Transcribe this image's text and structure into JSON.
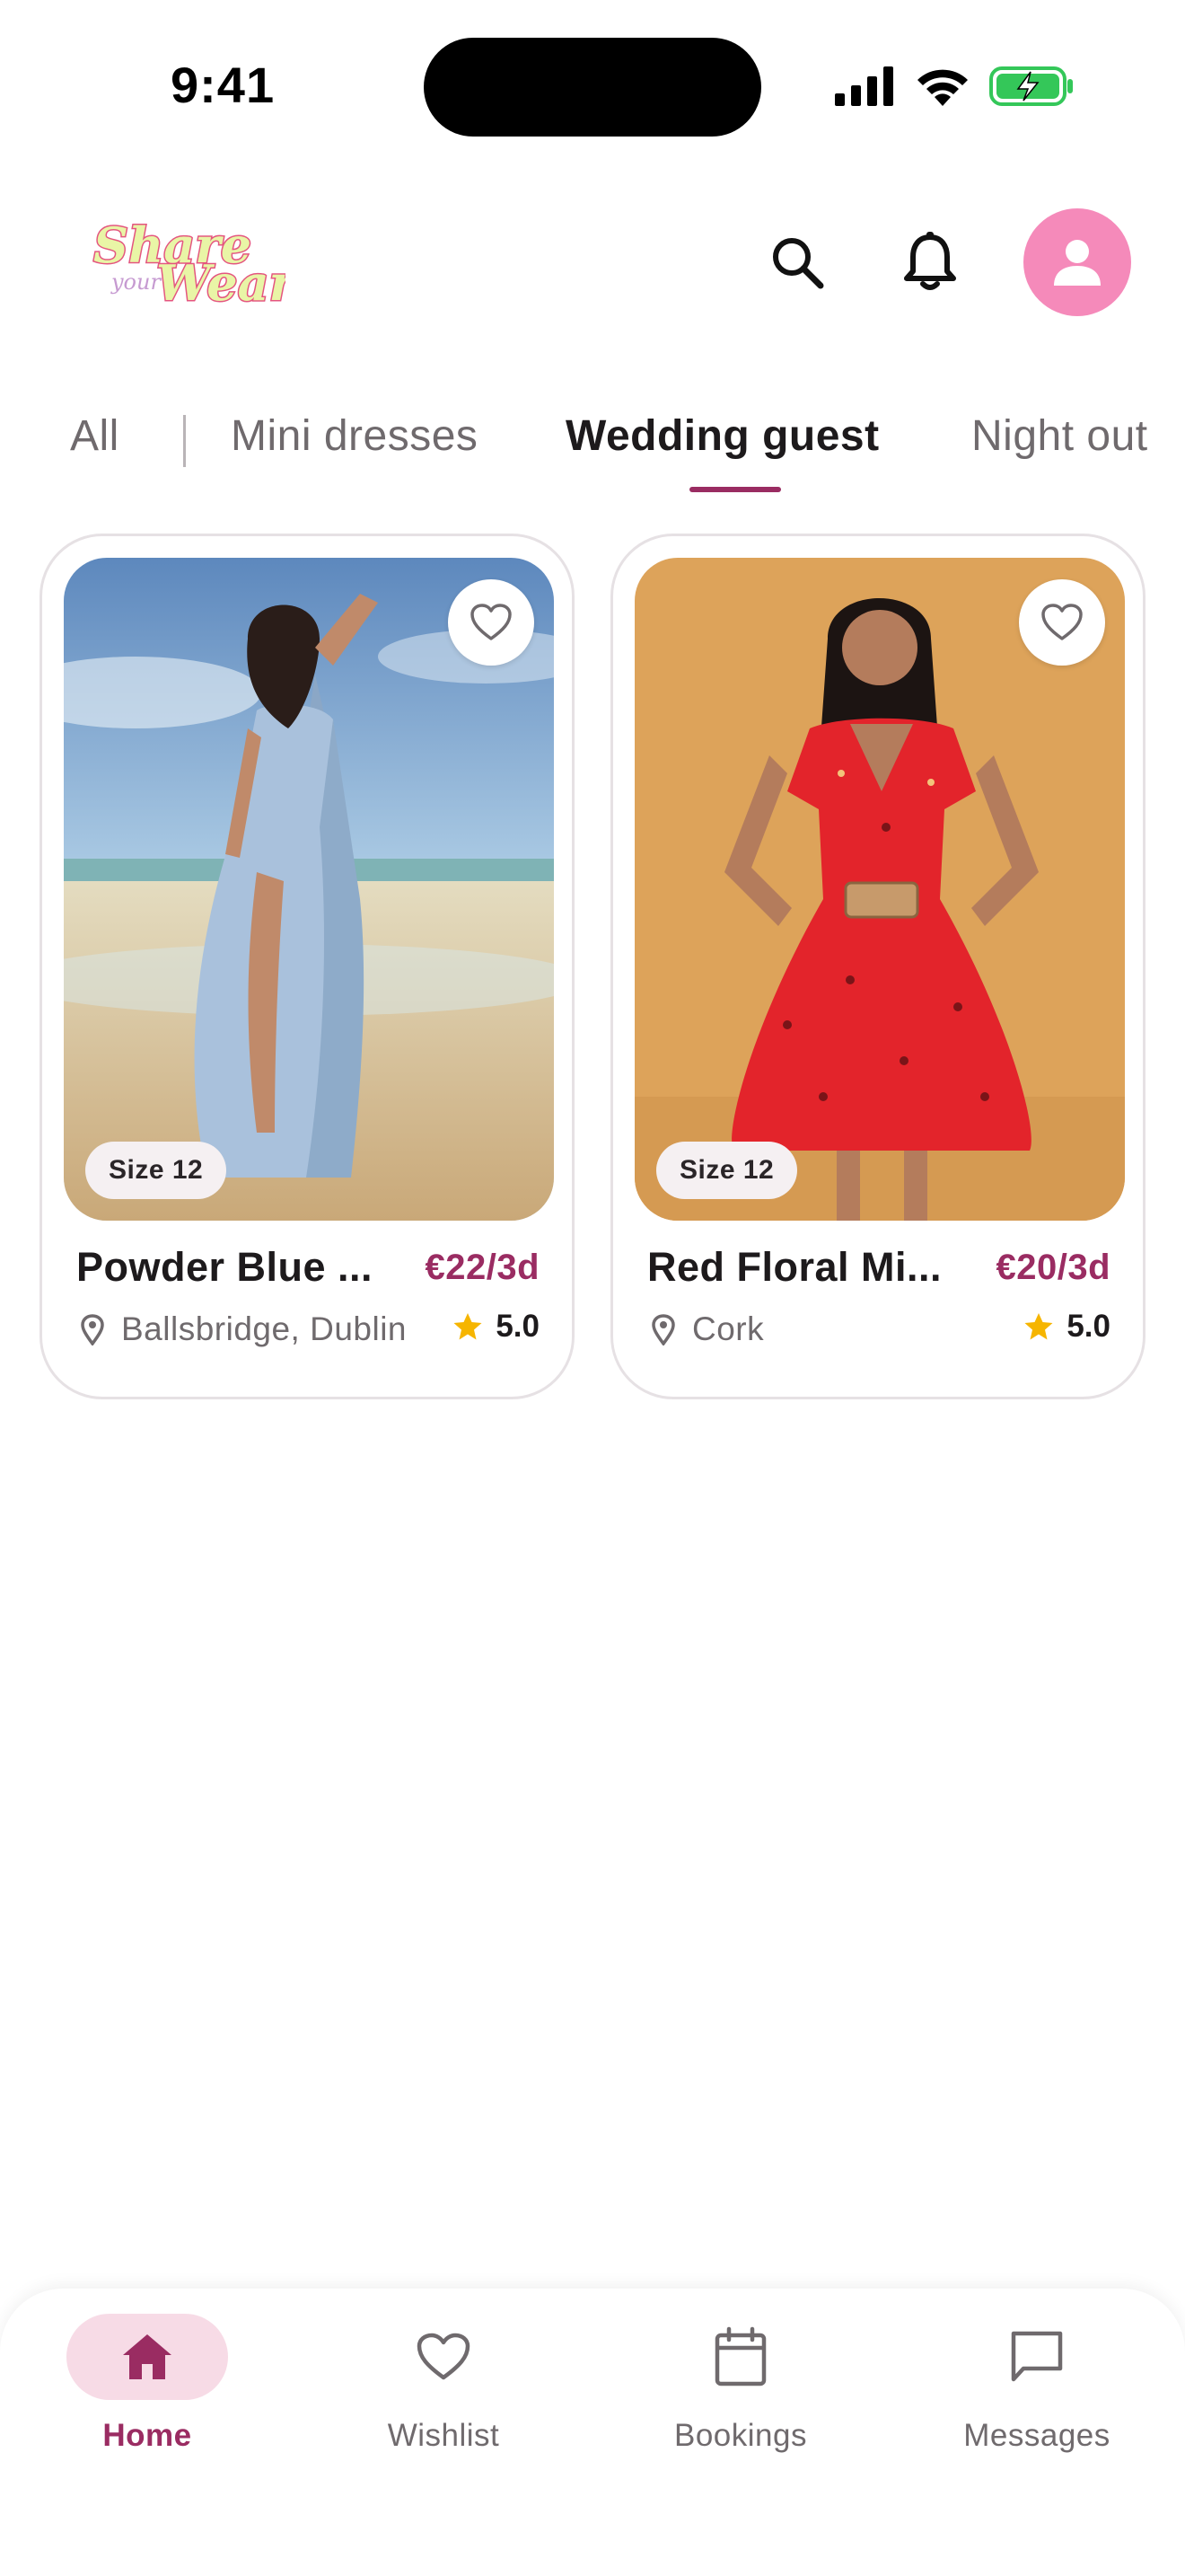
{
  "status_bar": {
    "time": "9:41",
    "icons": [
      "signal-icon",
      "wifi-icon",
      "battery-charging-icon"
    ]
  },
  "header": {
    "logo_text": "Share your Wear",
    "actions": [
      "search-icon",
      "bell-icon",
      "profile-icon"
    ]
  },
  "tabs": [
    {
      "label": "All",
      "active": false
    },
    {
      "label": "Mini dresses",
      "active": false
    },
    {
      "label": "Wedding guest",
      "active": true
    },
    {
      "label": "Night out",
      "active": false
    }
  ],
  "listings": [
    {
      "title": "Powder Blue ...",
      "price": "€22/3d",
      "size": "Size 12",
      "location": "Ballsbridge, Dublin",
      "rating": "5.0",
      "favorite": false
    },
    {
      "title": "Red Floral Mi...",
      "price": "€20/3d",
      "size": "Size 12",
      "location": "Cork",
      "rating": "5.0",
      "favorite": false
    }
  ],
  "bottom_nav": [
    {
      "label": "Home",
      "icon": "home-icon",
      "active": true
    },
    {
      "label": "Wishlist",
      "icon": "heart-icon",
      "active": false
    },
    {
      "label": "Bookings",
      "icon": "calendar-icon",
      "active": false
    },
    {
      "label": "Messages",
      "icon": "message-icon",
      "active": false
    }
  ],
  "colors": {
    "accent": "#9a2c62",
    "avatar_bg": "#f58aba",
    "nav_active_bg": "#f7dbe6",
    "star": "#f6b500",
    "battery": "#34c759"
  }
}
